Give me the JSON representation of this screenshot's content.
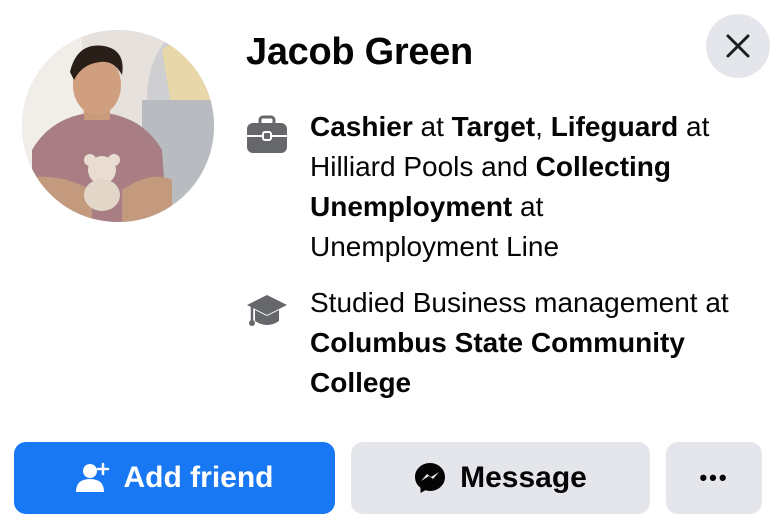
{
  "profile": {
    "name": "Jacob Green",
    "avatar_alt": "profile-photo"
  },
  "work": {
    "icon": "briefcase-icon",
    "job1_title": "Cashier",
    "job1_at": " at ",
    "job1_company": "Target",
    "sep1": ", ",
    "job2_title": "Lifeguard",
    "job2_at": " at Hilliard Pools and ",
    "job3_title": "Collecting Unemployment",
    "job3_at": " at Unemployment Line"
  },
  "education": {
    "icon": "graduation-cap-icon",
    "studied": "Studied Business management at ",
    "school": "Columbus State Community College"
  },
  "actions": {
    "add_friend_label": "Add friend",
    "message_label": "Message",
    "more_label": "•••"
  },
  "colors": {
    "primary": "#1877f2",
    "secondary_bg": "#e4e6eb",
    "text": "#050505",
    "icon_gray": "#65676b"
  }
}
